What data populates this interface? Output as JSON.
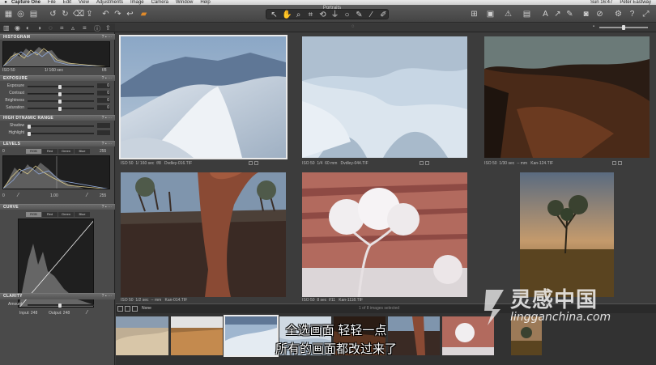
{
  "menubar": {
    "app": "Capture One",
    "items": [
      "File",
      "Edit",
      "View",
      "Adjustments",
      "Image",
      "Camera",
      "Window",
      "Help"
    ],
    "clock": "Sun 16:47",
    "user": "Peter Eastway"
  },
  "window": {
    "title": "Portraits"
  },
  "tool_panel": {
    "histogram": {
      "header": "HISTOGRAM",
      "iso": "ISO 50",
      "shutter": "1/ 160 sec",
      "aperture": "f/8"
    },
    "exposure": {
      "header": "EXPOSURE",
      "rows": [
        {
          "label": "Exposure",
          "value": "0"
        },
        {
          "label": "Contrast",
          "value": "0"
        },
        {
          "label": "Brightness",
          "value": "0"
        },
        {
          "label": "Saturation",
          "value": "0"
        }
      ]
    },
    "hdr": {
      "header": "HIGH DYNAMIC RANGE",
      "rows": [
        {
          "label": "Shadow",
          "value": ""
        },
        {
          "label": "Highlight",
          "value": ""
        }
      ]
    },
    "levels": {
      "header": "LEVELS",
      "channels": [
        "RGB",
        "Red",
        "Green",
        "Blue"
      ],
      "low": "0",
      "mid": "1.00",
      "high": "255",
      "out_low": "0",
      "out_high": "255"
    },
    "curve": {
      "header": "CURVE",
      "channels": [
        "RGB",
        "Red",
        "Green",
        "Blue"
      ],
      "input": "Input: 248",
      "output": "Output: 248"
    },
    "clarity": {
      "header": "CLARITY",
      "row_label": "Amount"
    }
  },
  "images": [
    {
      "caption_left": "ISO 50",
      "caption_mid": "1/ 160 sec",
      "caption_f": "f/8",
      "caption_file": "Dvdley-016.TIF"
    },
    {
      "caption_left": "ISO 50",
      "caption_mid": "1/4",
      "caption_f": "60 mm",
      "caption_file": "Dvdley-044.TIF"
    },
    {
      "caption_left": "ISO 50",
      "caption_mid": "1/30 sec",
      "caption_f": "-- mm",
      "caption_file": "Kan-124.TIF"
    },
    {
      "caption_left": "ISO 50",
      "caption_mid": "1/2 sec",
      "caption_f": "-- mm",
      "caption_file": "Kan-014.TIF"
    },
    {
      "caption_left": "ISO 50",
      "caption_mid": "8 sec",
      "caption_f": "f/11",
      "caption_file": "Kan-1118.TIF"
    }
  ],
  "filmstrip": {
    "filter": "None",
    "count": "1 of 8 images selected"
  },
  "subtitles": {
    "line1": "全选画面 轻轻一点",
    "line2": "所有的画面都改过来了"
  },
  "watermark": {
    "brand": "灵感中国",
    "url": "lingganchina.com"
  },
  "colors": {
    "selection": "#eaeaea",
    "panel": "#4a4a4a",
    "viewer": "#3c3c3c"
  }
}
